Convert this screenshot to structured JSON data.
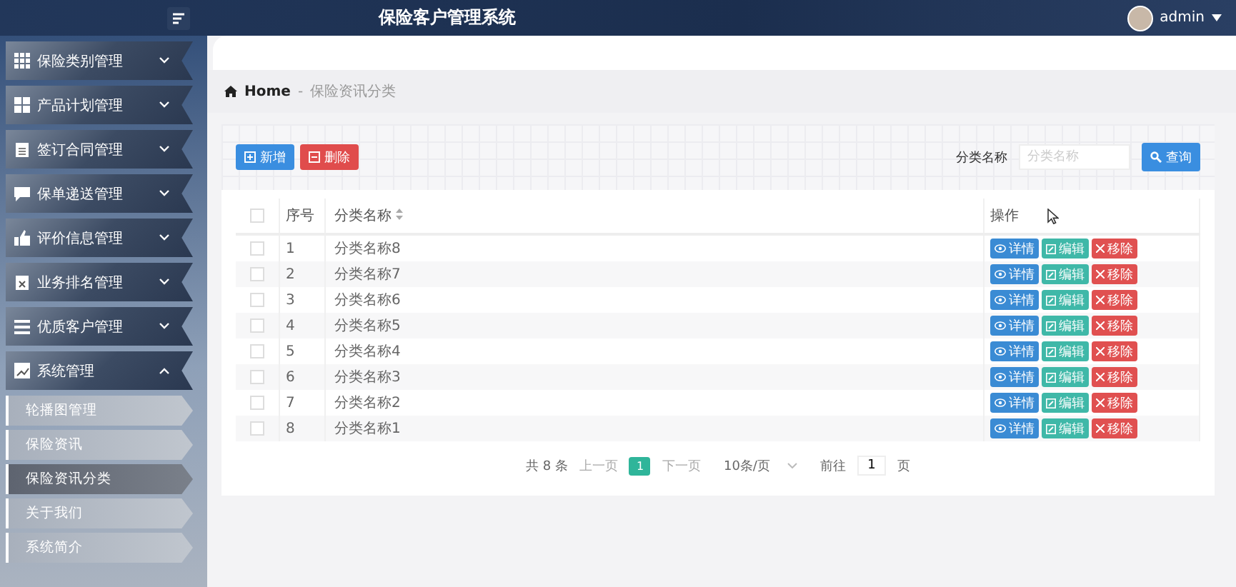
{
  "header": {
    "title": "保险客户管理系统",
    "username": "admin"
  },
  "sidebar": {
    "menus": [
      {
        "label": "保险类别管理",
        "kind": "grid",
        "expanded": false
      },
      {
        "label": "产品计划管理",
        "kind": "tiles",
        "expanded": false
      },
      {
        "label": "签订合同管理",
        "kind": "clipboard",
        "expanded": false
      },
      {
        "label": "保单递送管理",
        "kind": "comment",
        "expanded": false
      },
      {
        "label": "评价信息管理",
        "kind": "thumb",
        "expanded": false
      },
      {
        "label": "业务排名管理",
        "kind": "badge",
        "expanded": false
      },
      {
        "label": "优质客户管理",
        "kind": "list",
        "expanded": false
      },
      {
        "label": "系统管理",
        "kind": "chart",
        "expanded": true,
        "children": [
          {
            "label": "轮播图管理",
            "selected": false
          },
          {
            "label": "保险资讯",
            "selected": false
          },
          {
            "label": "保险资讯分类",
            "selected": true
          },
          {
            "label": "关于我们",
            "selected": false
          },
          {
            "label": "系统简介",
            "selected": false
          }
        ]
      }
    ]
  },
  "breadcrumb": {
    "home": "Home",
    "separator": "-",
    "current": "保险资讯分类"
  },
  "toolbar": {
    "add": "新增",
    "delete": "删除",
    "search_label": "分类名称",
    "search": {
      "placeholder": "分类名称"
    },
    "query": "查询"
  },
  "table": {
    "columns": [
      "序号",
      "分类名称",
      "操作"
    ],
    "all_checked": false,
    "rows": [
      {
        "index": "1",
        "name": "分类名称8",
        "checked": false,
        "actions": [
          {
            "kind": "view",
            "label": "详情"
          },
          {
            "kind": "edit",
            "label": "编辑"
          },
          {
            "kind": "remove",
            "label": "移除"
          }
        ]
      },
      {
        "index": "2",
        "name": "分类名称7",
        "checked": false,
        "actions": [
          {
            "kind": "view",
            "label": "详情"
          },
          {
            "kind": "edit",
            "label": "编辑"
          },
          {
            "kind": "remove",
            "label": "移除"
          }
        ]
      },
      {
        "index": "3",
        "name": "分类名称6",
        "checked": false,
        "actions": [
          {
            "kind": "view",
            "label": "详情"
          },
          {
            "kind": "edit",
            "label": "编辑"
          },
          {
            "kind": "remove",
            "label": "移除"
          }
        ]
      },
      {
        "index": "4",
        "name": "分类名称5",
        "checked": false,
        "actions": [
          {
            "kind": "view",
            "label": "详情"
          },
          {
            "kind": "edit",
            "label": "编辑"
          },
          {
            "kind": "remove",
            "label": "移除"
          }
        ]
      },
      {
        "index": "5",
        "name": "分类名称4",
        "checked": false,
        "actions": [
          {
            "kind": "view",
            "label": "详情"
          },
          {
            "kind": "edit",
            "label": "编辑"
          },
          {
            "kind": "remove",
            "label": "移除"
          }
        ]
      },
      {
        "index": "6",
        "name": "分类名称3",
        "checked": false,
        "actions": [
          {
            "kind": "view",
            "label": "详情"
          },
          {
            "kind": "edit",
            "label": "编辑"
          },
          {
            "kind": "remove",
            "label": "移除"
          }
        ]
      },
      {
        "index": "7",
        "name": "分类名称2",
        "checked": false,
        "actions": [
          {
            "kind": "view",
            "label": "详情"
          },
          {
            "kind": "edit",
            "label": "编辑"
          },
          {
            "kind": "remove",
            "label": "移除"
          }
        ]
      },
      {
        "index": "8",
        "name": "分类名称1",
        "checked": false,
        "actions": [
          {
            "kind": "view",
            "label": "详情"
          },
          {
            "kind": "edit",
            "label": "编辑"
          },
          {
            "kind": "remove",
            "label": "移除"
          }
        ]
      }
    ]
  },
  "pagination": {
    "total": "共 8 条",
    "prev": "上一页",
    "pages": [
      {
        "label": "1",
        "selected": true
      }
    ],
    "next": "下一页",
    "page_size": "10条/页",
    "goto_label": "前往",
    "goto_value": "1",
    "goto_suffix": "页"
  }
}
